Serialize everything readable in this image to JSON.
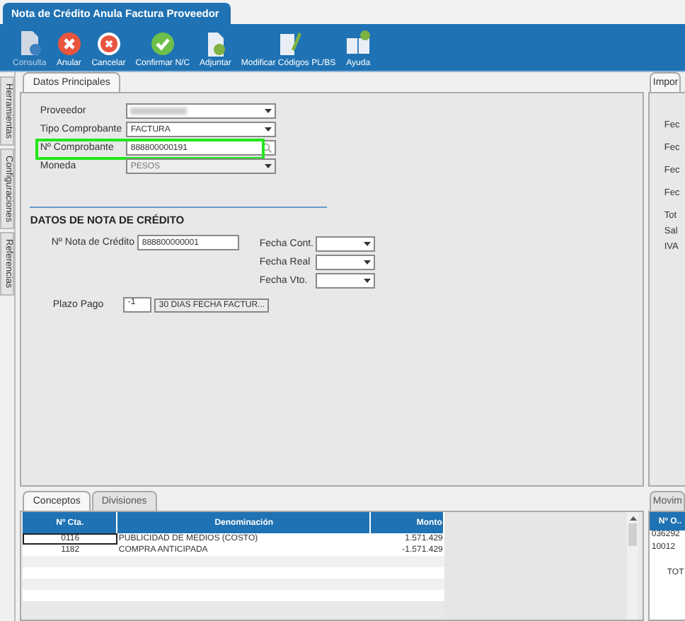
{
  "window": {
    "title": "Nota de Crédito Anula Factura Proveedor"
  },
  "toolbar": [
    {
      "label": "Consulta",
      "kind": "query",
      "disabled": true
    },
    {
      "label": "Anular",
      "kind": "cancel",
      "disabled": false
    },
    {
      "label": "Cancelar",
      "kind": "cancel-ring",
      "disabled": false
    },
    {
      "label": "Confirmar N/C",
      "kind": "confirm",
      "disabled": false
    },
    {
      "label": "Adjuntar",
      "kind": "attach",
      "disabled": false
    },
    {
      "label": "Modificar Códigos PL/BS",
      "kind": "edit",
      "disabled": false
    },
    {
      "label": "Ayuda",
      "kind": "help",
      "disabled": false
    }
  ],
  "side_tabs": [
    "Herramientas",
    "Configuraciones",
    "Referencias"
  ],
  "main_tab": {
    "label": "Datos Principales",
    "selected": true
  },
  "fields": [
    {
      "label": "Proveedor",
      "kind": "dropdown",
      "redacted": true,
      "disabled": false
    },
    {
      "label": "Tipo Comprobante",
      "kind": "dropdown",
      "value": "FACTURA",
      "disabled": false
    },
    {
      "label": "Nº Comprobante",
      "kind": "search",
      "value": "888800000191",
      "highlighted": true,
      "disabled": false
    },
    {
      "label": "Moneda",
      "kind": "dropdown",
      "value": "PESOS",
      "disabled": true
    }
  ],
  "section_title": "DATOS DE NOTA DE CRÉDITO",
  "nota": {
    "label": "Nº Nota de Crédito",
    "value": "888800000001"
  },
  "dates": [
    {
      "label": "Fecha Cont."
    },
    {
      "label": "Fecha Real"
    },
    {
      "label": "Fecha Vto."
    }
  ],
  "plazo": {
    "label": "Plazo Pago",
    "value": "-1",
    "button": "30 DIAS FECHA FACTUR..."
  },
  "right_panel": {
    "tab": "Impor",
    "labels": [
      "Fec",
      "Fec",
      "Fec",
      "Fec",
      "Tot",
      "Sal",
      "IVA"
    ]
  },
  "bottom_tabs": [
    {
      "label": "Conceptos",
      "selected": true
    },
    {
      "label": "Divisiones",
      "selected": false
    }
  ],
  "table": {
    "columns": [
      "Nº Cta.",
      "Denominación",
      "Monto"
    ],
    "rows": [
      {
        "cells": [
          "0116",
          "PUBLICIDAD DE MEDIOS (COSTO)",
          "1.571.429"
        ],
        "selected": true
      },
      {
        "cells": [
          "1182",
          "COMPRA ANTICIPADA",
          "-1.571.429"
        ],
        "selected": false
      }
    ]
  },
  "movements": {
    "tab": "Movim",
    "column": "Nº O..",
    "rows": [
      {
        "cell": "036292",
        "kind": "row"
      },
      {
        "cell": "10012",
        "kind": "row"
      },
      {
        "cell": "TOT",
        "kind": "total"
      }
    ]
  }
}
